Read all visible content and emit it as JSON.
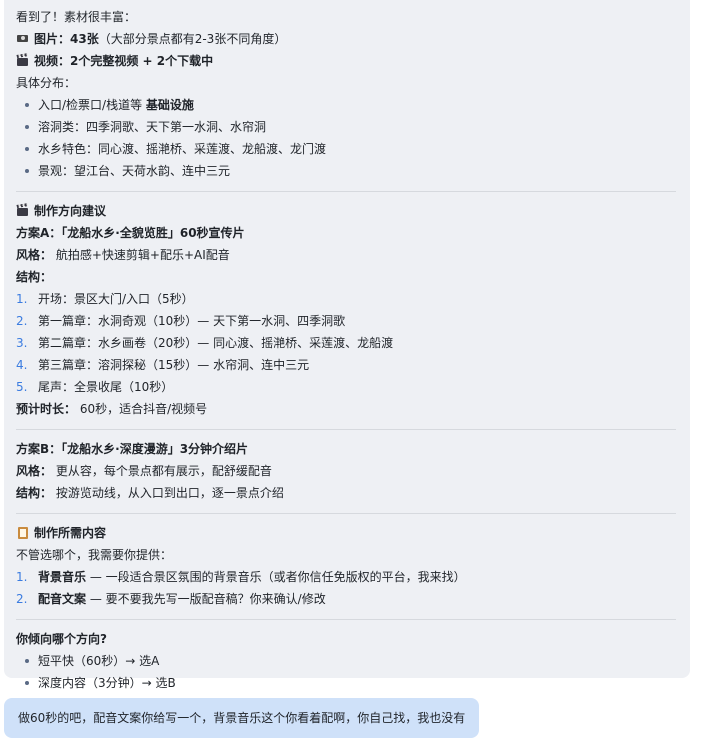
{
  "ai_message": {
    "intro": "看到了！素材很丰富：",
    "photos": {
      "icon": "camera-icon",
      "label": "图片：",
      "count": "43张",
      "note": "（大部分景点都有2-3张不同角度）"
    },
    "videos": {
      "icon": "clapper-icon",
      "text": "视频：2个完整视频 + 2个下载中"
    },
    "dist_title": "具体分布：",
    "dist_items": [
      {
        "text": "入口/检票口/栈道等 ",
        "bold": "基础设施"
      },
      {
        "text": "溶洞类：四季洞歌、天下第一水洞、水帘洞",
        "bold": ""
      },
      {
        "text": "水乡特色：同心渡、摇滟桥、采莲渡、龙船渡、龙门渡",
        "bold": ""
      },
      {
        "text": "景观：望江台、天荷水韵、连中三元",
        "bold": ""
      }
    ],
    "section_direction": {
      "icon": "clapper-icon",
      "title": "制作方向建议"
    },
    "plan_a": {
      "title": "方案A：「龙船水乡·全貌览胜」60秒宣传片",
      "style_label": "风格：",
      "style_value": " 航拍感+快速剪辑+配乐+AI配音",
      "structure_label": "结构：",
      "steps": [
        "开场：景区大门/入口（5秒）",
        "第一篇章：水洞奇观（10秒）— 天下第一水洞、四季洞歌",
        "第二篇章：水乡画卷（20秒）— 同心渡、摇滟桥、采莲渡、龙船渡",
        "第三篇章：溶洞探秘（15秒）— 水帘洞、连中三元",
        "尾声：全景收尾（10秒）"
      ],
      "duration_label": "预计时长：",
      "duration_value": " 60秒，适合抖音/视频号"
    },
    "plan_b": {
      "title": "方案B：「龙船水乡·深度漫游」3分钟介绍片",
      "style_label": "风格：",
      "style_value": " 更从容，每个景点都有展示，配舒缓配音",
      "structure_label": "结构：",
      "structure_value": " 按游览动线，从入口到出口，逐一景点介绍"
    },
    "section_content": {
      "icon": "clipboard-icon",
      "title": "制作所需内容"
    },
    "need_intro": "不管选哪个，我需要你提供：",
    "needs": [
      {
        "bold": "背景音乐",
        "text": " — 一段适合景区氛围的背景音乐（或者你信任免版权的平台，我来找）"
      },
      {
        "bold": "配音文案",
        "text": " — 要不要我先写一版配音稿？你来确认/修改"
      }
    ],
    "question": "你倾向哪个方向?",
    "options": [
      "短平快（60秒）→ 选A",
      "深度内容（3分钟）→ 选B"
    ]
  },
  "user_message": {
    "text": "做60秒的吧，配音文案你给写一个，背景音乐这个你看着配啊，你自己找，我也没有"
  },
  "colors": {
    "ai_bubble_bg": "#eef0f4",
    "user_bubble_bg": "#cfe1f9",
    "list_number": "#3b7ce0"
  }
}
